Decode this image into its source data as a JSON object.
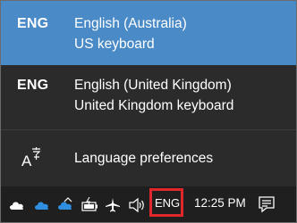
{
  "language_flyout": {
    "items": [
      {
        "code": "ENG",
        "name": "English (Australia)",
        "layout": "US keyboard",
        "selected": true
      },
      {
        "code": "ENG",
        "name": "English (United Kingdom)",
        "layout": "United Kingdom keyboard",
        "selected": false
      }
    ],
    "preferences": {
      "label": "Language preferences",
      "icon": "language-settings-icon"
    }
  },
  "taskbar": {
    "tray_icons": [
      "onedrive-cloud-icon",
      "onedrive-cloud-icon",
      "onedrive-cloud-icon",
      "chevron-up-icon",
      "battery-charging-icon",
      "airplane-mode-icon",
      "volume-icon"
    ],
    "input_indicator": "ENG",
    "clock": "12:25 PM",
    "notification_icon": "action-center-icon"
  },
  "colors": {
    "selected_item": "#4a8ac6",
    "flyout_background": "#2b2b2b",
    "taskbar_background": "#1f1f1f",
    "highlight_border": "#e0282c",
    "onedrive_blue": "#2f8ee0"
  }
}
